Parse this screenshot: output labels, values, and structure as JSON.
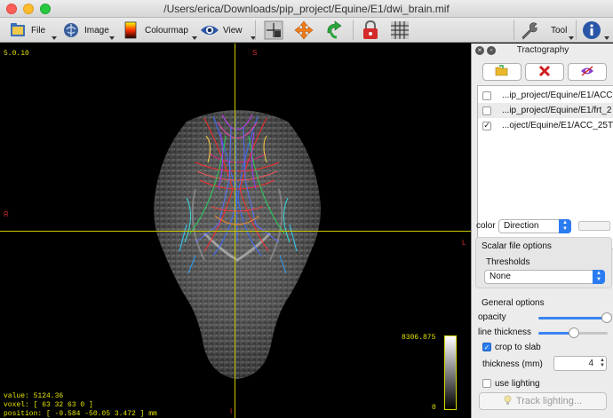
{
  "window": {
    "title": "/Users/erica/Downloads/pip_project/Equine/E1/dwi_brain.mif"
  },
  "toolbar": {
    "file_label": "File",
    "image_label": "Image",
    "colourmap_label": "Colourmap",
    "view_label": "View",
    "tool_label": "Tool"
  },
  "viewport": {
    "version": "5.0.10",
    "orientation_top": "S",
    "orientation_left": "R",
    "orientation_right": "L",
    "orientation_bottom": "I",
    "value_text": "value: 5124.36",
    "voxel_text": "voxel: [ 63 32 63 0 ]",
    "position_text": "position: [ -9.584 -50.05 3.472 ] mm",
    "colorbar_max": "8306.875",
    "colorbar_min": "0"
  },
  "tractography": {
    "title": "Tractography",
    "tracks": [
      {
        "name": "...ip_project/Equine/E1/ACC",
        "checked": false
      },
      {
        "name": "...ip_project/Equine/E1/frt_2",
        "checked": false
      },
      {
        "name": "...oject/Equine/E1/ACC_25T",
        "checked": true
      }
    ],
    "color_label": "color",
    "color_value": "Direction",
    "scalar_file_options_label": "Scalar file options",
    "thresholds_label": "Thresholds",
    "thresholds_value": "None",
    "general_options_label": "General options",
    "opacity_label": "opacity",
    "opacity_value": 1.0,
    "line_thickness_label": "line thickness",
    "line_thickness_value": 0.7,
    "crop_to_slab_label": "crop to slab",
    "crop_to_slab_checked": true,
    "thickness_label": "thickness (mm)",
    "thickness_value": "4",
    "use_lighting_label": "use lighting",
    "use_lighting_checked": false,
    "track_lighting_label": "Track lighting..."
  },
  "colors": {
    "overlay_text": "#e4e400",
    "orientation": "#d23030",
    "accent": "#2b7cf0"
  }
}
